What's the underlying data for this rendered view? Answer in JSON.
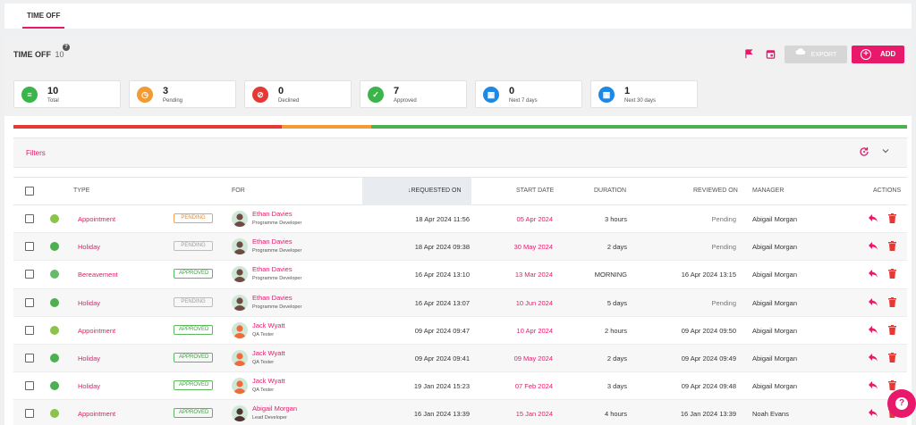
{
  "top_tab": "TIME OFF",
  "header": {
    "title": "TIME OFF",
    "count": "10",
    "help": "?",
    "export_label": "EXPORT",
    "add_label": "ADD"
  },
  "stats": [
    {
      "value": "10",
      "label": "Total",
      "color": "#3bb54a",
      "icon": "list-icon",
      "glyph": "≡"
    },
    {
      "value": "3",
      "label": "Pending",
      "color": "#f29a33",
      "icon": "clock-icon",
      "glyph": "◷"
    },
    {
      "value": "0",
      "label": "Declined",
      "color": "#e53935",
      "icon": "block-icon",
      "glyph": "⊘"
    },
    {
      "value": "7",
      "label": "Approved",
      "color": "#3bb54a",
      "icon": "check-icon",
      "glyph": "✓"
    },
    {
      "value": "0",
      "label": "Next 7 days",
      "color": "#1e88e5",
      "icon": "calendar-icon",
      "glyph": "▦"
    },
    {
      "value": "1",
      "label": "Next 30 days",
      "color": "#1e88e5",
      "icon": "calendar-icon",
      "glyph": "▦"
    }
  ],
  "status_bar": [
    {
      "label": "Declined",
      "fraction": 0.3,
      "color": "#e53935"
    },
    {
      "label": "Pending",
      "fraction": 0.1,
      "color": "#f29a33"
    },
    {
      "label": "Approved",
      "fraction": 0.6,
      "color": "#4caf50"
    }
  ],
  "filters": {
    "label": "Filters"
  },
  "columns": {
    "type": "TYPE",
    "for": "FOR",
    "requested_on": "REQUESTED ON",
    "start_date": "START DATE",
    "duration": "DURATION",
    "reviewed_on": "REVIEWED ON",
    "manager": "MANAGER",
    "actions": "ACTIONS"
  },
  "rows": [
    {
      "type": "Appointment",
      "type_color": "#8bc34a",
      "status": "PENDING",
      "status_style": "pending",
      "name": "Ethan Davies",
      "role": "Programme Developer",
      "avatar_color": "#6d4c41",
      "requested": "18 Apr 2024 11:56",
      "start": "05 Apr 2024",
      "duration": "3 hours",
      "reviewed": "Pending",
      "manager": "Abigail Morgan"
    },
    {
      "type": "Holiday",
      "type_color": "#4caf50",
      "status": "PENDING",
      "status_style": "pending-grey",
      "name": "Ethan Davies",
      "role": "Programme Developer",
      "avatar_color": "#6d4c41",
      "requested": "18 Apr 2024 09:38",
      "start": "30 May 2024",
      "duration": "2 days",
      "reviewed": "Pending",
      "manager": "Abigail Morgan"
    },
    {
      "type": "Bereavement",
      "type_color": "#66bb6a",
      "status": "APPROVED",
      "status_style": "approved",
      "name": "Ethan Davies",
      "role": "Programme Developer",
      "avatar_color": "#6d4c41",
      "requested": "16 Apr 2024 13:10",
      "start": "13 Mar 2024",
      "duration": "MORNING",
      "reviewed": "16 Apr 2024 13:15",
      "manager": "Abigail Morgan"
    },
    {
      "type": "Holiday",
      "type_color": "#4caf50",
      "status": "PENDING",
      "status_style": "pending-grey",
      "name": "Ethan Davies",
      "role": "Programme Developer",
      "avatar_color": "#6d4c41",
      "requested": "16 Apr 2024 13:07",
      "start": "10 Jun 2024",
      "duration": "5 days",
      "reviewed": "Pending",
      "manager": "Abigail Morgan"
    },
    {
      "type": "Appointment",
      "type_color": "#8bc34a",
      "status": "APPROVED",
      "status_style": "approved",
      "name": "Jack Wyatt",
      "role": "QA Tester",
      "avatar_color": "#ef6c3a",
      "requested": "09 Apr 2024 09:47",
      "start": "10 Apr 2024",
      "duration": "2 hours",
      "reviewed": "09 Apr 2024 09:50",
      "manager": "Abigail Morgan"
    },
    {
      "type": "Holiday",
      "type_color": "#4caf50",
      "status": "APPROVED",
      "status_style": "approved",
      "name": "Jack Wyatt",
      "role": "QA Tester",
      "avatar_color": "#ef6c3a",
      "requested": "09 Apr 2024 09:41",
      "start": "09 May 2024",
      "duration": "2 days",
      "reviewed": "09 Apr 2024 09:49",
      "manager": "Abigail Morgan"
    },
    {
      "type": "Holiday",
      "type_color": "#4caf50",
      "status": "APPROVED",
      "status_style": "approved",
      "name": "Jack Wyatt",
      "role": "QA Tester",
      "avatar_color": "#ef6c3a",
      "requested": "19 Jan 2024 15:23",
      "start": "07 Feb 2024",
      "duration": "3 days",
      "reviewed": "09 Apr 2024 09:48",
      "manager": "Abigail Morgan"
    },
    {
      "type": "Appointment",
      "type_color": "#8bc34a",
      "status": "APPROVED",
      "status_style": "approved",
      "name": "Abigail Morgan",
      "role": "Lead Developer",
      "avatar_color": "#4e342e",
      "requested": "16 Jan 2024 13:39",
      "start": "15 Jan 2024",
      "duration": "4 hours",
      "reviewed": "16 Jan 2024 13:39",
      "manager": "Noah Evans"
    }
  ]
}
